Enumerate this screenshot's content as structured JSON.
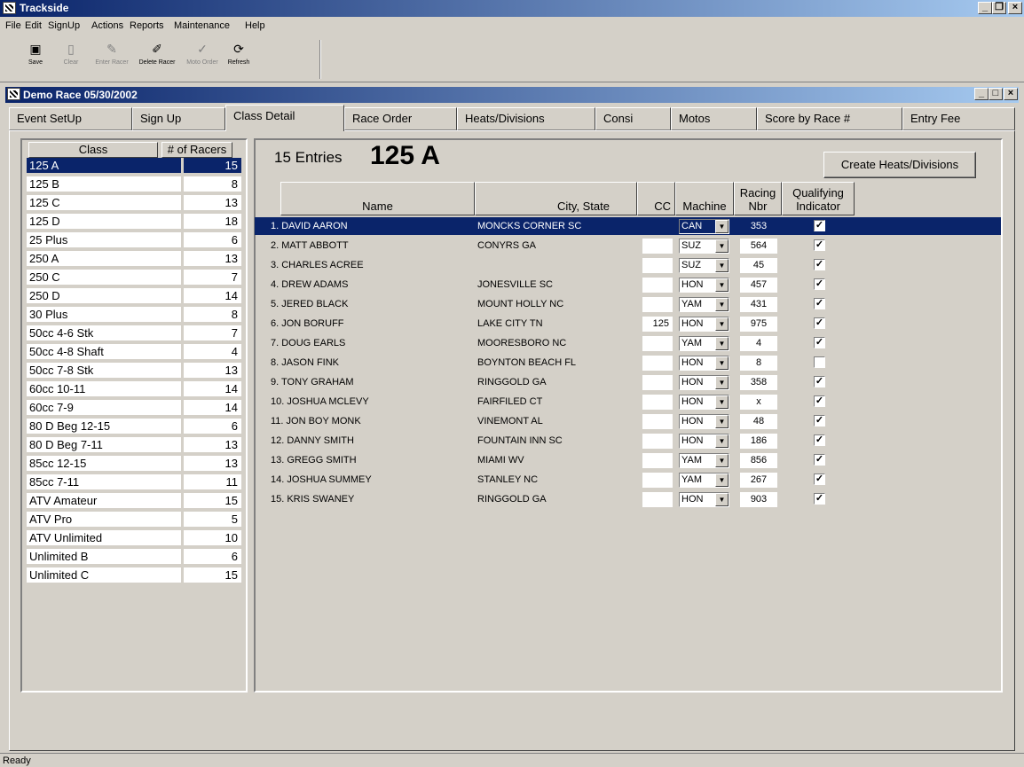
{
  "app": {
    "title": "Trackside"
  },
  "menu": [
    "File",
    "Edit",
    "SignUp",
    "Actions",
    "Reports",
    "Maintenance",
    "Help"
  ],
  "toolbar": [
    {
      "label": "Save",
      "icon": "floppy-icon",
      "enabled": true
    },
    {
      "label": "Clear",
      "icon": "blank-page-icon",
      "enabled": false
    },
    {
      "label": "Enter Racer",
      "icon": "pencil-icon",
      "enabled": false
    },
    {
      "label": "Delete Racer",
      "icon": "eraser-icon",
      "enabled": true
    },
    {
      "label": "Moto Order",
      "icon": "checkmark-icon",
      "enabled": false
    },
    {
      "label": "Refresh",
      "icon": "refresh-icon",
      "enabled": true
    }
  ],
  "child_window": {
    "title": "Demo Race  05/30/2002"
  },
  "tabs": [
    "Event SetUp",
    "Sign Up",
    "Class Detail",
    "Race Order",
    "Heats/Divisions",
    "Consi",
    "Motos",
    "Score by Race #",
    "Entry Fee"
  ],
  "active_tab": "Class Detail",
  "class_list": {
    "headers": [
      "Class",
      "# of Racers"
    ],
    "rows": [
      {
        "name": "125 A",
        "count": "15",
        "selected": true
      },
      {
        "name": "125 B",
        "count": "8"
      },
      {
        "name": "125 C",
        "count": "13"
      },
      {
        "name": "125 D",
        "count": "18"
      },
      {
        "name": "25 Plus",
        "count": "6"
      },
      {
        "name": "250 A",
        "count": "13"
      },
      {
        "name": "250 C",
        "count": "7"
      },
      {
        "name": "250 D",
        "count": "14"
      },
      {
        "name": "30 Plus",
        "count": "8"
      },
      {
        "name": "50cc 4-6 Stk",
        "count": "7"
      },
      {
        "name": "50cc 4-8 Shaft",
        "count": "4"
      },
      {
        "name": "50cc 7-8 Stk",
        "count": "13"
      },
      {
        "name": "60cc 10-11",
        "count": "14"
      },
      {
        "name": "60cc 7-9",
        "count": "14"
      },
      {
        "name": "80 D Beg 12-15",
        "count": "6"
      },
      {
        "name": "80 D Beg 7-11",
        "count": "13"
      },
      {
        "name": "85cc 12-15",
        "count": "13"
      },
      {
        "name": "85cc 7-11",
        "count": "11"
      },
      {
        "name": "ATV Amateur",
        "count": "15"
      },
      {
        "name": "ATV Pro",
        "count": "5"
      },
      {
        "name": "ATV Unlimited",
        "count": "10"
      },
      {
        "name": "Unlimited B",
        "count": "6"
      },
      {
        "name": "Unlimited C",
        "count": "15"
      }
    ]
  },
  "detail": {
    "entries_label": "15 Entries",
    "class_name": "125 A",
    "create_button": "Create Heats/Divisions",
    "columns": {
      "name": "Name",
      "city": "City, State",
      "cc": "CC",
      "machine": "Machine",
      "racing1": "Racing",
      "racing2": "Nbr",
      "qual1": "Qualifying",
      "qual2": "Indicator"
    },
    "entries": [
      {
        "name": "1. DAVID  AARON",
        "city": "MONCKS CORNER SC",
        "cc": "",
        "machine": "CAN",
        "nbr": "353",
        "qualifying": true,
        "selected": true
      },
      {
        "name": "2. MATT  ABBOTT",
        "city": "CONYRS GA",
        "cc": "",
        "machine": "SUZ",
        "nbr": "564",
        "qualifying": true
      },
      {
        "name": "3. CHARLES  ACREE",
        "city": "",
        "cc": "",
        "machine": "SUZ",
        "nbr": "45",
        "qualifying": true
      },
      {
        "name": "4. DREW  ADAMS",
        "city": "JONESVILLE SC",
        "cc": "",
        "machine": "HON",
        "nbr": "457",
        "qualifying": true
      },
      {
        "name": "5. JERED  BLACK",
        "city": "MOUNT HOLLY NC",
        "cc": "",
        "machine": "YAM",
        "nbr": "431",
        "qualifying": true
      },
      {
        "name": "6. JON  BORUFF",
        "city": "LAKE CITY TN",
        "cc": "125",
        "machine": "HON",
        "nbr": "975",
        "qualifying": true
      },
      {
        "name": "7. DOUG  EARLS",
        "city": "MOORESBORO NC",
        "cc": "",
        "machine": "YAM",
        "nbr": "4",
        "qualifying": true
      },
      {
        "name": "8. JASON  FINK",
        "city": "BOYNTON BEACH FL",
        "cc": "",
        "machine": "HON",
        "nbr": "8",
        "qualifying": false
      },
      {
        "name": "9. TONY  GRAHAM",
        "city": "RINGGOLD GA",
        "cc": "",
        "machine": "HON",
        "nbr": "358",
        "qualifying": true
      },
      {
        "name": "10. JOSHUA  MCLEVY",
        "city": "FAIRFILED CT",
        "cc": "",
        "machine": "HON",
        "nbr": "x",
        "qualifying": true
      },
      {
        "name": "11. JON BOY  MONK",
        "city": "VINEMONT AL",
        "cc": "",
        "machine": "HON",
        "nbr": "48",
        "qualifying": true
      },
      {
        "name": "12. DANNY  SMITH",
        "city": "FOUNTAIN INN SC",
        "cc": "",
        "machine": "HON",
        "nbr": "186",
        "qualifying": true
      },
      {
        "name": "13. GREGG  SMITH",
        "city": "MIAMI WV",
        "cc": "",
        "machine": "YAM",
        "nbr": "856",
        "qualifying": true
      },
      {
        "name": "14. JOSHUA  SUMMEY",
        "city": "STANLEY NC",
        "cc": "",
        "machine": "YAM",
        "nbr": "267",
        "qualifying": true
      },
      {
        "name": "15. KRIS  SWANEY",
        "city": "RINGGOLD GA",
        "cc": "",
        "machine": "HON",
        "nbr": "903",
        "qualifying": true
      }
    ]
  },
  "status": "Ready"
}
